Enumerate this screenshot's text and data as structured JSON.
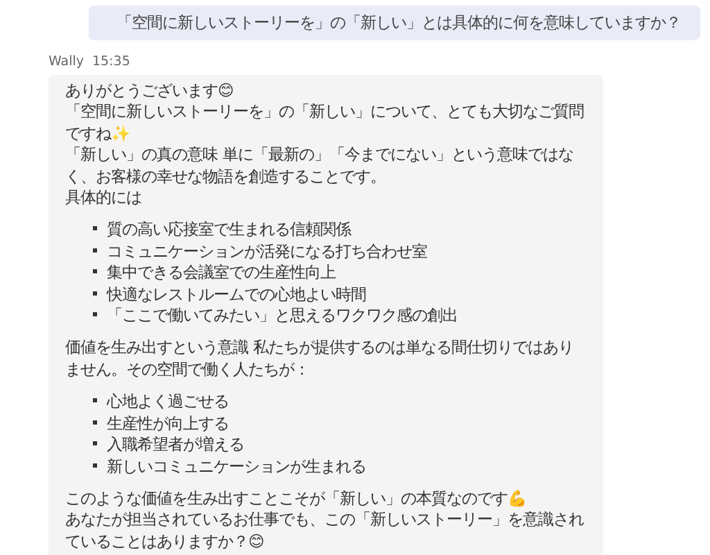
{
  "user_message": {
    "text": "「空間に新しいストーリーを」の「新しい」とは具体的に何を意味していますか？"
  },
  "reply": {
    "sender": "Wally",
    "time": "15:35",
    "blocks": [
      {
        "kind": "text",
        "lines": [
          "ありがとうございます😊",
          "「空間に新しいストーリーを」の「新しい」について、とても大切なご質問ですね✨",
          "「新しい」の真の意味 単に「最新の」「今までにない」という意味ではなく、お客様の幸せな物語を創造することです。",
          "具体的には"
        ]
      },
      {
        "kind": "list",
        "items": [
          "質の高い応接室で生まれる信頼関係",
          "コミュニケーションが活発になる打ち合わせ室",
          "集中できる会議室での生産性向上",
          "快適なレストルームでの心地よい時間",
          "「ここで働いてみたい」と思えるワクワク感の創出"
        ]
      },
      {
        "kind": "text",
        "lines": [
          "価値を生み出すという意識 私たちが提供するのは単なる間仕切りではありません。その空間で働く人たちが："
        ]
      },
      {
        "kind": "list",
        "items": [
          "心地よく過ごせる",
          "生産性が向上する",
          "入職希望者が増える",
          "新しいコミュニケーションが生まれる"
        ]
      },
      {
        "kind": "text",
        "lines": [
          "このような価値を生み出すことこそが「新しい」の本質なのです💪",
          "あなたが担当されているお仕事でも、この「新しいストーリー」を意識されていることはありますか？😊"
        ]
      }
    ]
  }
}
